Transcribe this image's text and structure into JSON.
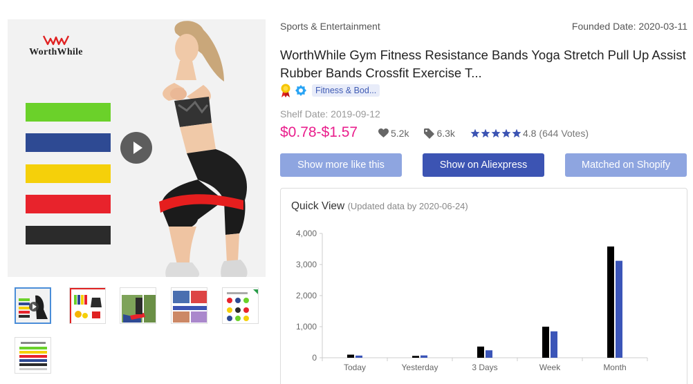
{
  "gallery": {
    "brand_logo_text": "WorthWhile",
    "band_colors": [
      "#6bd12a",
      "#2e4a93",
      "#f5d00a",
      "#e8232c",
      "#2b2b2b"
    ],
    "thumbnails": [
      {
        "label": "Product photo 1 - video",
        "active": true
      },
      {
        "label": "Product photo 2",
        "active": false
      },
      {
        "label": "Product photo 3",
        "active": false
      },
      {
        "label": "Product photo 4",
        "active": false
      },
      {
        "label": "Product photo 5",
        "active": false
      },
      {
        "label": "Product photo 6",
        "active": false
      }
    ]
  },
  "product": {
    "category": "Sports & Entertainment",
    "founded": "Founded Date: 2020-03-11",
    "title": "WorthWhile Gym Fitness Resistance Bands Yoga Stretch Pull Up Assist Rubber Bands Crossfit Exercise T...",
    "tag": "Fitness & Bod...",
    "shelf_date": "Shelf Date: 2019-09-12",
    "price": "$0.78-$1.57",
    "likes": "5.2k",
    "orders": "6.3k",
    "rating": "4.8",
    "stars": 5,
    "votes": "(644 Votes)"
  },
  "actions": {
    "show_more": "Show more like this",
    "show_on_aliexpress": "Show on Aliexpress",
    "matched_on_shopify": "Matched on Shopify"
  },
  "quick_view": {
    "title": "Quick View",
    "subtitle": "(Updated data by 2020-06-24)"
  },
  "colors": {
    "accent": "#3c54b3",
    "accent_light": "#8ea5e0",
    "price": "#e91e8c",
    "series_1": "#000000",
    "series_2": "#3b55b8"
  },
  "chart_data": {
    "type": "bar",
    "categories": [
      "Today",
      "Yesterday",
      "3 Days",
      "Week",
      "Month"
    ],
    "series": [
      {
        "values": [
          100,
          60,
          360,
          1000,
          3580
        ]
      },
      {
        "values": [
          70,
          75,
          240,
          850,
          3120
        ]
      }
    ],
    "ylim": [
      0,
      4000
    ],
    "yticks": [
      "0",
      "1,000",
      "2,000",
      "3,000",
      "4,000"
    ],
    "grid": false
  }
}
